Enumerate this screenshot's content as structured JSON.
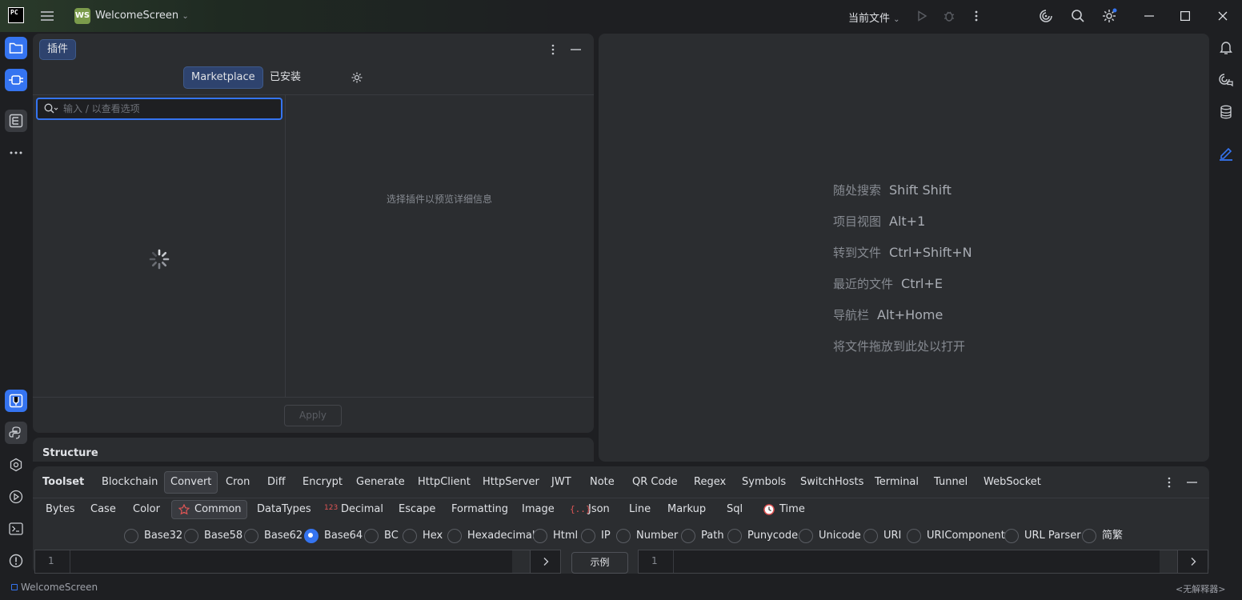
{
  "titlebar": {
    "logo": "PC",
    "project_badge": "WS",
    "project_name": "WelcomeScreen",
    "run_config": "当前文件"
  },
  "plugins": {
    "panel_title": "插件",
    "tabs": [
      "Marketplace",
      "已安装"
    ],
    "search_placeholder": "输入 / 以查看选项",
    "empty_detail": "选择插件以预览详细信息",
    "apply_label": "Apply"
  },
  "structure": {
    "title": "Structure"
  },
  "welcome": {
    "hints": [
      {
        "label": "随处搜索",
        "key": "Shift Shift"
      },
      {
        "label": "项目视图",
        "key": "Alt+1"
      },
      {
        "label": "转到文件",
        "key": "Ctrl+Shift+N"
      },
      {
        "label": "最近的文件",
        "key": "Ctrl+E"
      },
      {
        "label": "导航栏",
        "key": "Alt+Home"
      }
    ],
    "drop_hint": "将文件拖放到此处以打开"
  },
  "toolset": {
    "title": "Toolset",
    "tabs": [
      "Blockchain",
      "Convert",
      "Cron",
      "Diff",
      "Encrypt",
      "Generate",
      "HttpClient",
      "HttpServer",
      "JWT",
      "Note",
      "QR Code",
      "Regex",
      "Symbols",
      "SwitchHosts",
      "Terminal",
      "Tunnel",
      "WebSocket"
    ],
    "selected_tab": "Convert",
    "sub_tabs": [
      "Bytes",
      "Case",
      "Color",
      "Common",
      "DataTypes",
      "Decimal",
      "Escape",
      "Formatting",
      "Image",
      "Json",
      "Line",
      "Markup",
      "Sql",
      "Time"
    ],
    "selected_sub_tab": "Common",
    "decimal_icon_text": "123",
    "json_icon_text": "{..}",
    "options": [
      "Base32",
      "Base58",
      "Base62",
      "Base64",
      "BC",
      "Hex",
      "Hexadecimal",
      "Html",
      "IP",
      "Number",
      "Path",
      "Punycode",
      "Unicode",
      "URI",
      "URIComponent",
      "URL Parser",
      "简繁"
    ],
    "selected_option": "Base64",
    "example_label": "示例",
    "left_line": "1",
    "right_line": "1"
  },
  "statusbar": {
    "project": "WelcomeScreen",
    "interpreter": "<无解释器>"
  },
  "colors": {
    "accent": "#3574f0",
    "background": "#1e1f22",
    "panel": "#2b2d30"
  }
}
